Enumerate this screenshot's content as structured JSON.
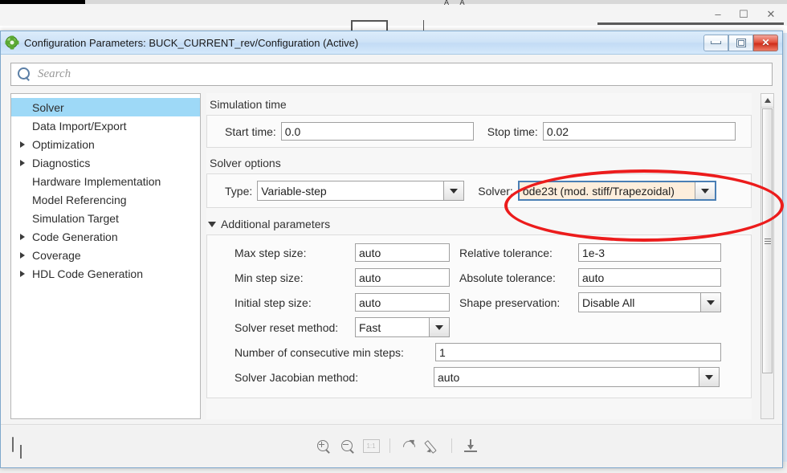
{
  "background_window": {
    "minimize_glyph": "–",
    "maximize_glyph": "☐",
    "close_glyph": "✕",
    "tiny_marks": "A A"
  },
  "dialog": {
    "icon": "gear-icon",
    "title": "Configuration Parameters: BUCK_CURRENT_rev/Configuration (Active)",
    "window_buttons": {
      "minimize": "minimize-button",
      "maximize": "maximize-button",
      "close": "close-button"
    }
  },
  "search": {
    "placeholder": "Search",
    "icon": "search-icon"
  },
  "sidebar": {
    "items": [
      {
        "label": "Solver",
        "expandable": false,
        "selected": true
      },
      {
        "label": "Data Import/Export",
        "expandable": false,
        "selected": false
      },
      {
        "label": "Optimization",
        "expandable": true,
        "selected": false
      },
      {
        "label": "Diagnostics",
        "expandable": true,
        "selected": false
      },
      {
        "label": "Hardware Implementation",
        "expandable": false,
        "selected": false
      },
      {
        "label": "Model Referencing",
        "expandable": false,
        "selected": false
      },
      {
        "label": "Simulation Target",
        "expandable": false,
        "selected": false
      },
      {
        "label": "Code Generation",
        "expandable": true,
        "selected": false
      },
      {
        "label": "Coverage",
        "expandable": true,
        "selected": false
      },
      {
        "label": "HDL Code Generation",
        "expandable": true,
        "selected": false
      }
    ]
  },
  "main": {
    "simulation_time": {
      "group_title": "Simulation time",
      "start_time_label": "Start time:",
      "start_time_value": "0.0",
      "stop_time_label": "Stop time:",
      "stop_time_value": "0.02"
    },
    "solver_options": {
      "group_title": "Solver options",
      "type_label": "Type:",
      "type_value": "Variable-step",
      "solver_label": "Solver:",
      "solver_value": "ode23t (mod. stiff/Trapezoidal)"
    },
    "additional_parameters": {
      "section_title": "Additional parameters",
      "expanded": true,
      "max_step_size_label": "Max step size:",
      "max_step_size_value": "auto",
      "relative_tolerance_label": "Relative tolerance:",
      "relative_tolerance_value": "1e-3",
      "min_step_size_label": "Min step size:",
      "min_step_size_value": "auto",
      "absolute_tolerance_label": "Absolute tolerance:",
      "absolute_tolerance_value": "auto",
      "initial_step_size_label": "Initial step size:",
      "initial_step_size_value": "auto",
      "shape_preservation_label": "Shape preservation:",
      "shape_preservation_value": "Disable All",
      "solver_reset_method_label": "Solver reset method:",
      "solver_reset_method_value": "Fast",
      "consecutive_min_steps_label": "Number of consecutive min steps:",
      "consecutive_min_steps_value": "1",
      "solver_jacobian_method_label": "Solver Jacobian method:",
      "solver_jacobian_method_value": "auto"
    }
  },
  "bottom_toolbar": {
    "icons": [
      "panel-layout-icon",
      "zoom-in-icon",
      "zoom-out-icon",
      "actual-size-icon",
      "redo-icon",
      "edit-pencil-icon",
      "download-icon"
    ],
    "actual_size_label": "1:1"
  },
  "scrollbar": {
    "name": "vertical-scrollbar",
    "up_arrow": "scroll-up-arrow"
  },
  "annotation": {
    "type": "ellipse-highlight",
    "color": "#ec1c1c",
    "target": "solver-combobox"
  }
}
